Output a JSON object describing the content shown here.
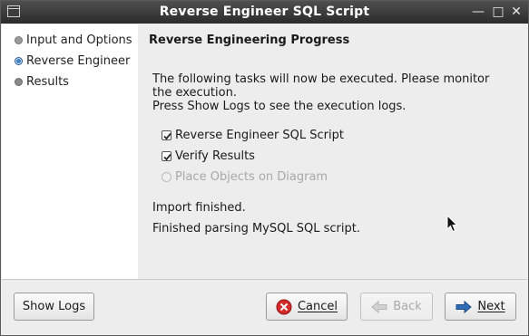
{
  "window": {
    "title": "Reverse Engineer SQL Script",
    "controls": {
      "minimize": "—",
      "maximize": "□",
      "close": "✕"
    }
  },
  "sidebar": {
    "steps": [
      {
        "label": "Input and Options",
        "state": "done"
      },
      {
        "label": "Reverse Engineer",
        "state": "current"
      },
      {
        "label": "Results",
        "state": "pending"
      }
    ]
  },
  "main": {
    "heading": "Reverse Engineering Progress",
    "intro_line1": "The following tasks will now be executed. Please monitor",
    "intro_line2": "the execution.",
    "intro_line3": "Press Show Logs to see the execution logs.",
    "tasks": [
      {
        "label": "Reverse Engineer SQL Script",
        "checked": true,
        "enabled": true
      },
      {
        "label": "Verify Results",
        "checked": true,
        "enabled": true
      },
      {
        "label": "Place Objects on Diagram",
        "checked": false,
        "enabled": false
      }
    ],
    "status1": "Import finished.",
    "status2": "Finished parsing MySQL SQL script."
  },
  "buttons": {
    "show_logs": "Show Logs",
    "cancel": "Cancel",
    "back": "Back",
    "next": "Next"
  },
  "colors": {
    "accent": "#3e7fc1",
    "cancel_icon": "#d42b2b",
    "next_arrow": "#2f6db5"
  }
}
